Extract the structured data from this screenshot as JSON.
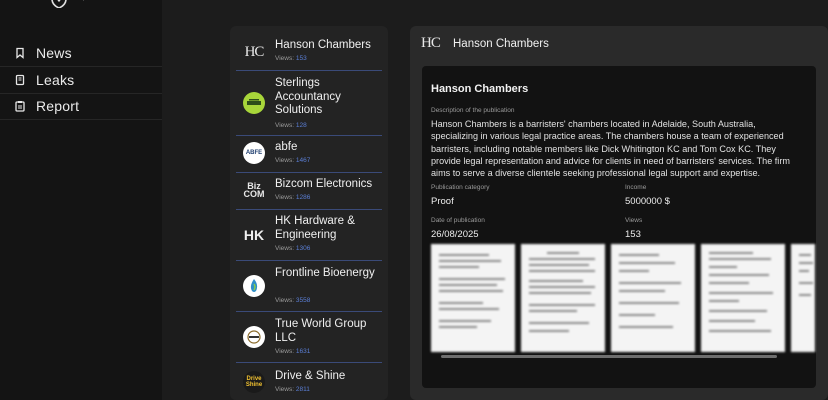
{
  "nav": {
    "items": [
      {
        "label": "News",
        "icon": "bookmark-icon"
      },
      {
        "label": "Leaks",
        "icon": "book-icon"
      },
      {
        "label": "Report",
        "icon": "clipboard-icon"
      }
    ]
  },
  "list": {
    "views_prefix": "Views:",
    "items": [
      {
        "name": "Hanson Chambers",
        "views": "153",
        "avatar": "HC"
      },
      {
        "name": "Sterlings Accountancy Solutions",
        "views": "128",
        "avatar": ""
      },
      {
        "name": "abfe",
        "views": "1467",
        "avatar": "ABFE"
      },
      {
        "name": "Bizcom Electronics",
        "views": "1286",
        "avatar": "Biz COM"
      },
      {
        "name": "HK Hardware & Engineering",
        "views": "1306",
        "avatar": "HK"
      },
      {
        "name": "Frontline Bioenergy",
        "views": "3558",
        "avatar": ""
      },
      {
        "name": "True World Group LLC",
        "views": "1631",
        "avatar": ""
      },
      {
        "name": "Drive & Shine",
        "views": "2811",
        "avatar": "Drive Shine"
      }
    ]
  },
  "detail": {
    "header_logo": "HC",
    "header_title": "Hanson Chambers",
    "title": "Hanson Chambers",
    "description_label": "Description of the publication",
    "description": "Hanson Chambers is a barristers' chambers located in Adelaide, South Australia, specializing in various legal practice areas. The chambers house a team of experienced barristers, including notable members like Dick Whitington KC and Tom Cox KC. They provide legal representation and advice for clients in need of barristers' services. The firm aims to serve a diverse clientele seeking professional legal support and expertise.",
    "category_label": "Publication category",
    "category": "Proof",
    "income_label": "Income",
    "income": "5000000 $",
    "date_label": "Date of publication",
    "date": "26/08/2025",
    "views_label": "Views",
    "views": "153"
  }
}
